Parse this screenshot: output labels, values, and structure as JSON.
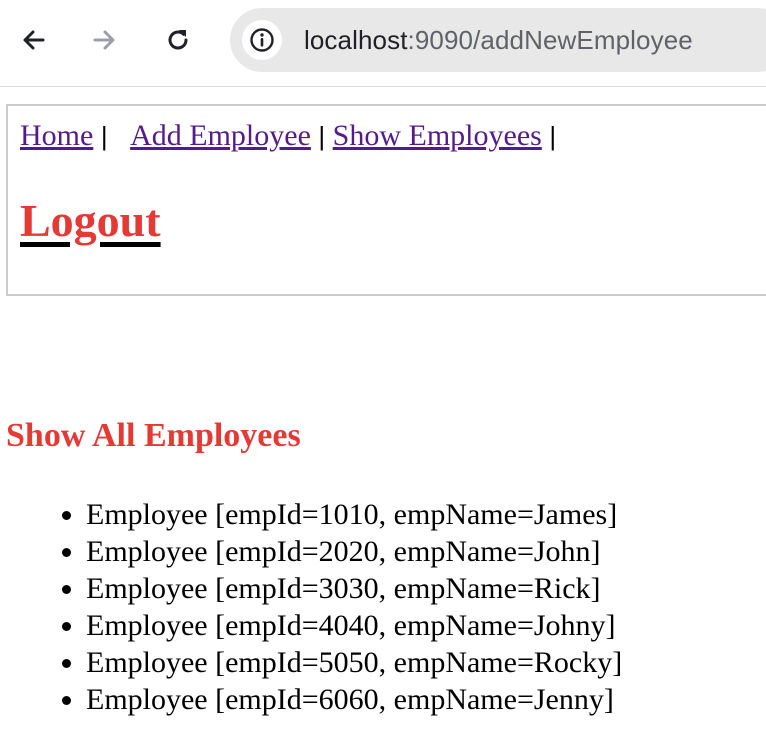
{
  "browser": {
    "back_icon": "arrow-left-icon",
    "forward_icon": "arrow-right-icon",
    "reload_icon": "reload-icon",
    "site_info_icon": "info-icon",
    "url_host": "localhost",
    "url_rest": ":9090/addNewEmployee"
  },
  "nav": {
    "home_label": "Home",
    "add_label": "Add Employee",
    "show_label": "Show Employees",
    "separator": "|",
    "logout_label": "Logout"
  },
  "main": {
    "title": "Show All Employees",
    "employees": [
      "Employee [empId=1010, empName=James]",
      "Employee [empId=2020, empName=John]",
      "Employee [empId=3030, empName=Rick]",
      "Employee [empId=4040, empName=Johny]",
      "Employee [empId=5050, empName=Rocky]",
      "Employee [empId=6060, empName=Jenny]"
    ]
  },
  "colors": {
    "link": "#551a8b",
    "accent_red": "#e53935",
    "omnibox_bg": "#e8e8e8"
  }
}
